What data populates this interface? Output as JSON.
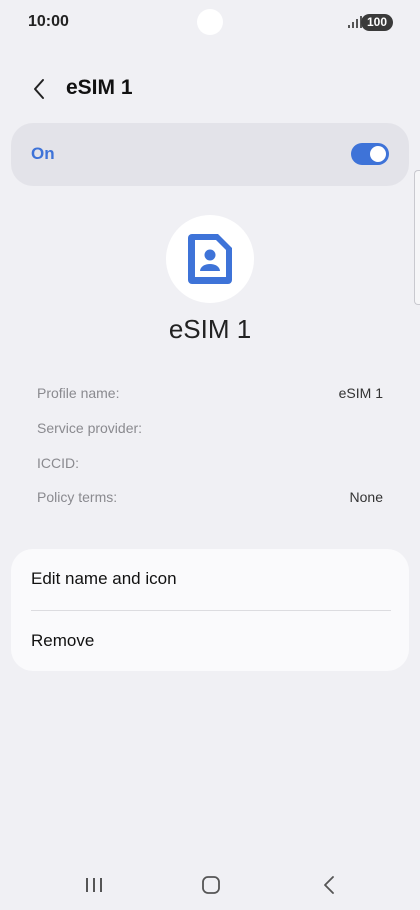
{
  "status_bar": {
    "time": "10:00",
    "battery": "100"
  },
  "header": {
    "title": "eSIM 1"
  },
  "toggle_card": {
    "label": "On",
    "state": "on",
    "accent_color": "#3e73d8"
  },
  "profile": {
    "icon": "sim-card-person-icon",
    "name": "eSIM 1"
  },
  "info": [
    {
      "label": "Profile name:",
      "value": "eSIM 1"
    },
    {
      "label": "Service provider:",
      "value": ""
    },
    {
      "label": "ICCID:",
      "value": ""
    },
    {
      "label": "Policy terms:",
      "value": "None"
    }
  ],
  "menu": {
    "items": [
      {
        "label": "Edit name and icon"
      },
      {
        "label": "Remove"
      }
    ]
  },
  "nav": {
    "recents_icon": "recents-icon",
    "home_icon": "home-icon",
    "back_icon": "back-icon"
  }
}
